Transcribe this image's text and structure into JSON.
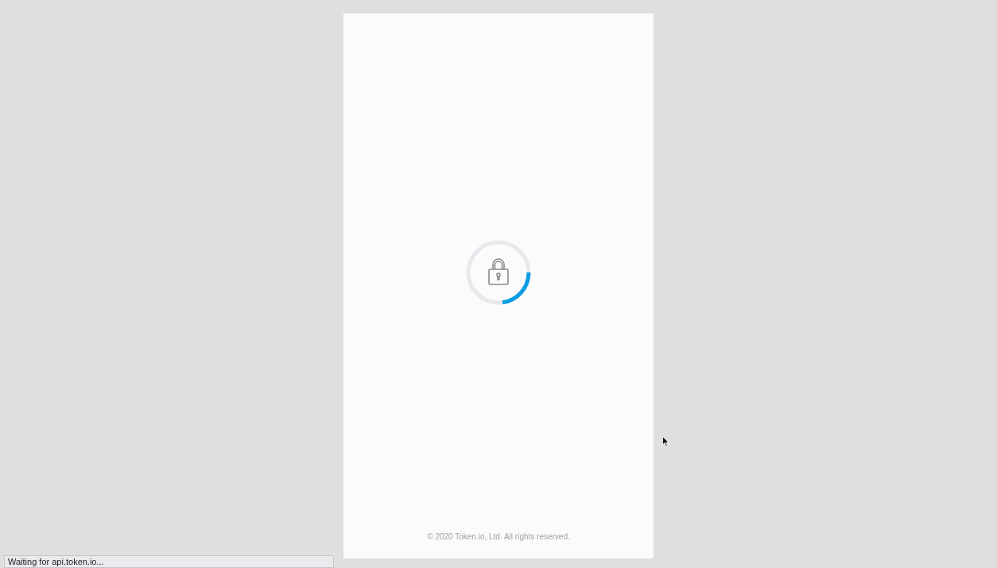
{
  "card": {
    "footer": "© 2020 Token.io, Ltd. All rights reserved."
  },
  "status_bar": {
    "text": "Waiting for api.token.io..."
  }
}
